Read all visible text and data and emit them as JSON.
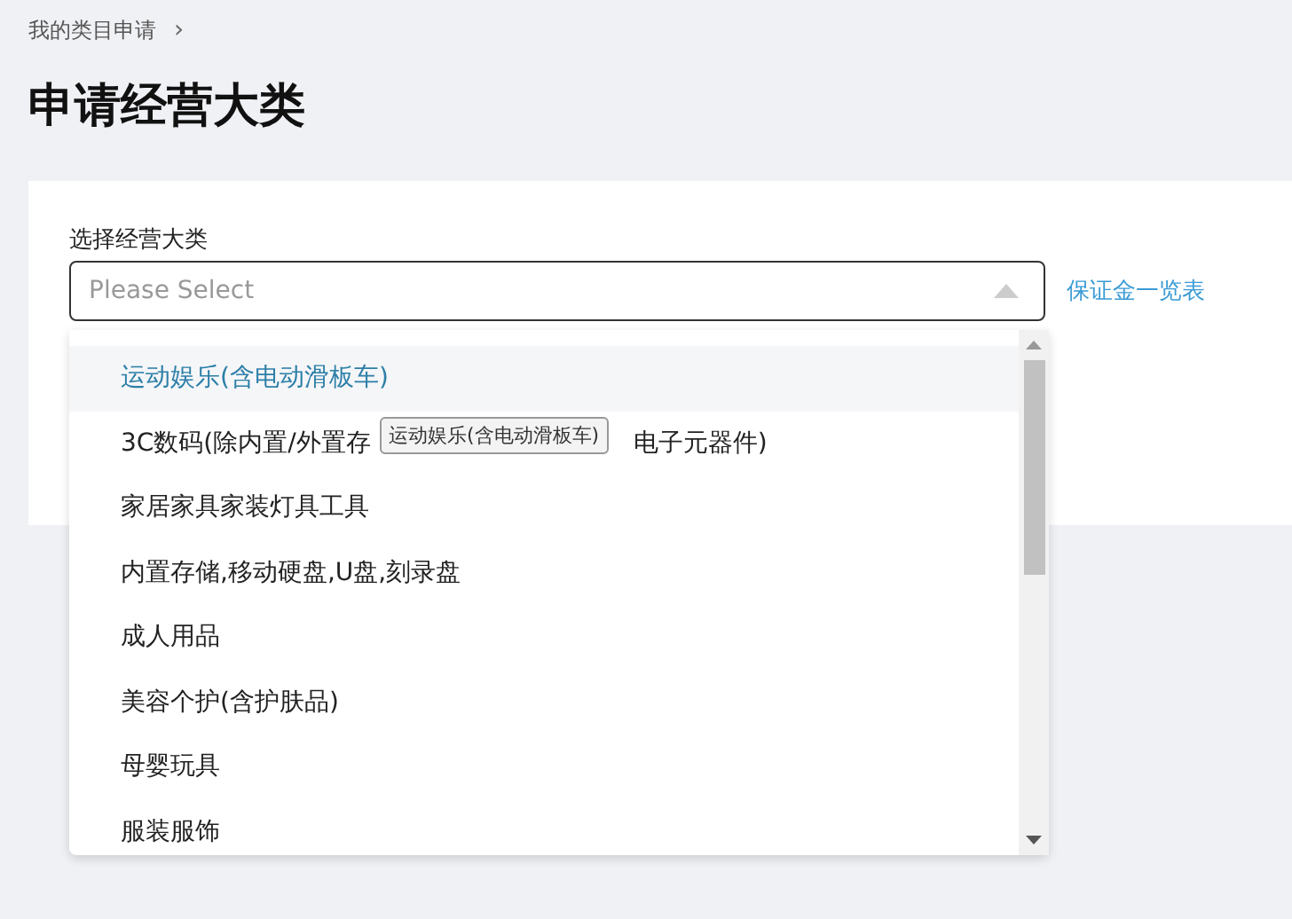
{
  "breadcrumb": {
    "label": "我的类目申请",
    "separator": "›"
  },
  "title": "申请经营大类",
  "form": {
    "label": "选择经营大类",
    "select": {
      "placeholder": "Please Select",
      "expanded": true
    },
    "link": "保证金一览表"
  },
  "dropdown": {
    "items": [
      {
        "parts": [
          "运动娱乐(含电动滑板车)"
        ],
        "selected": true
      },
      {
        "parts": [
          "3C数码(除内置/外置存",
          "电子元器件)"
        ],
        "selected": false
      },
      {
        "parts": [
          "家居家具家装灯具工具"
        ],
        "selected": false
      },
      {
        "parts": [
          "内置存储,移动硬盘,U盘,刻录盘"
        ],
        "selected": false
      },
      {
        "parts": [
          "成人用品"
        ],
        "selected": false
      },
      {
        "parts": [
          "美容个护(含护肤品)"
        ],
        "selected": false
      },
      {
        "parts": [
          "母婴玩具"
        ],
        "selected": false
      },
      {
        "parts": [
          "服装服饰"
        ],
        "selected": false
      }
    ],
    "tooltip": "运动娱乐(含电动滑板车)"
  }
}
